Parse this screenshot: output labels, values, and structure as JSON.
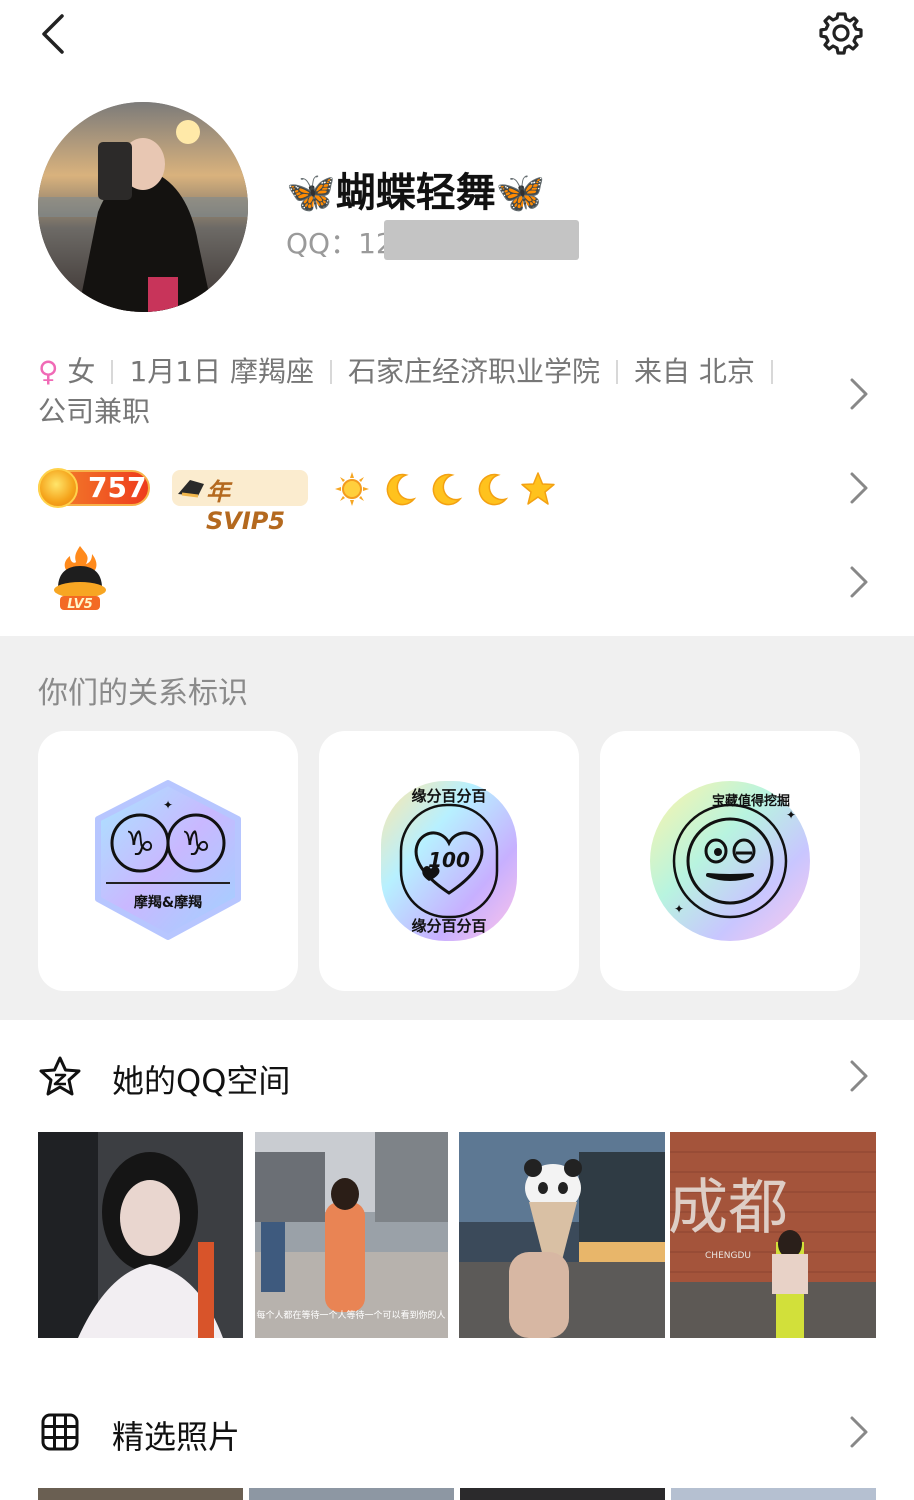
{
  "topbar": {
    "back_icon": "chevron-left-icon",
    "settings_icon": "gear-icon"
  },
  "profile": {
    "nickname": "🦋蝴蝶轻舞🦋",
    "qq_label": "QQ：12",
    "gender_symbol": "♀",
    "info": [
      "女",
      "1月1日 摩羯座",
      "石家庄经济职业学院",
      "来自 北京",
      "公司兼职"
    ]
  },
  "badges": {
    "level_number": "757",
    "svip_label": "年SVIP5",
    "level_icons": [
      "sun-icon",
      "moon-icon",
      "moon-icon",
      "moon-icon",
      "star-icon"
    ],
    "fire_level": "LV5"
  },
  "relation": {
    "title": "你们的关系标识",
    "cards": [
      {
        "icon": "capricorn-pair-badge",
        "label": "摩羯&摩羯"
      },
      {
        "icon": "heart-100-badge",
        "label": "缘分百分百",
        "heart_text": "100"
      },
      {
        "icon": "treasure-face-badge",
        "label": "宝藏值得挖掘"
      }
    ]
  },
  "qzone": {
    "title": "她的QQ空间",
    "icon": "qzone-star-icon",
    "photo_captions": [
      "",
      "每个人都在等待一个人等待一个可以看到你的人",
      "",
      "成都"
    ],
    "photo_subtext": "CHENGDU"
  },
  "featured": {
    "title": "精选照片",
    "icon": "grid-icon"
  },
  "colors": {
    "accent_orange": "#ee3b1d",
    "svip_gold": "#b4691f",
    "female_pink": "#f06ab6",
    "section_gray": "#f0f0f0"
  }
}
